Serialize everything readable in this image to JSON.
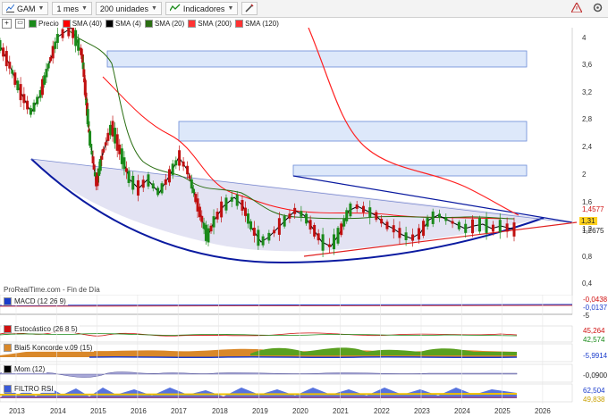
{
  "toolbar": {
    "symbol": "GAM",
    "period": "1 mes",
    "units": "200 unidades",
    "indicators": "Indicadores"
  },
  "legend": {
    "price": "Precio",
    "items": [
      {
        "label": "SMA (40)",
        "color": "#ff0000"
      },
      {
        "label": "SMA (4)",
        "color": "#000000"
      },
      {
        "label": "SMA (20)",
        "color": "#2a6e12"
      },
      {
        "label": "SMA (200)",
        "color": "#ff3333"
      },
      {
        "label": "SMA (120)",
        "color": "#ff3333"
      }
    ]
  },
  "watermark": "ProRealTime.com - Fin de Día",
  "price_axis": [
    "4",
    "3,6",
    "3,2",
    "2,8",
    "2,4",
    "2",
    "1,6",
    "1,2",
    "0,8",
    "0,4"
  ],
  "price_tags": [
    {
      "text": "1,4577",
      "color": "#d01010"
    },
    {
      "text": "1,31",
      "color": "#000000",
      "bg": "#ffd21f"
    },
    {
      "text": "1,2675",
      "color": "#000000"
    }
  ],
  "panels": [
    {
      "title": "MACD (12 26 9)",
      "values": [
        {
          "text": "-0,0438",
          "color": "#d01010"
        },
        {
          "text": "-0,0137",
          "color": "#1a3ccc"
        }
      ],
      "scale": "-5"
    },
    {
      "title": "Estocástico (26 8 5)",
      "values": [
        {
          "text": "45,264",
          "color": "#d01010"
        },
        {
          "text": "42,574",
          "color": "#1a8a1a"
        }
      ],
      "scale": ""
    },
    {
      "title": "Blai5 Koncorde v.09 (15)",
      "values": [
        {
          "text": "-5,9914",
          "color": "#1a3ccc"
        }
      ],
      "scale": ""
    },
    {
      "title": "Mom (12)",
      "values": [
        {
          "text": "-0,0900",
          "color": "#000000"
        }
      ],
      "scale": ""
    },
    {
      "title": "FILTRO RSI",
      "values": [
        {
          "text": "62,504",
          "color": "#1a3ccc"
        },
        {
          "text": "49,838",
          "color": "#c8a000"
        }
      ],
      "scale": ""
    }
  ],
  "years": [
    "2013",
    "2014",
    "2015",
    "2016",
    "2017",
    "2018",
    "2019",
    "2020",
    "2021",
    "2022",
    "2023",
    "2024",
    "2025",
    "2026"
  ],
  "colors": {
    "up": "#1a8a1a",
    "down": "#c01010",
    "zone": "#dde8fa",
    "wedge": "#0a1aa0"
  }
}
